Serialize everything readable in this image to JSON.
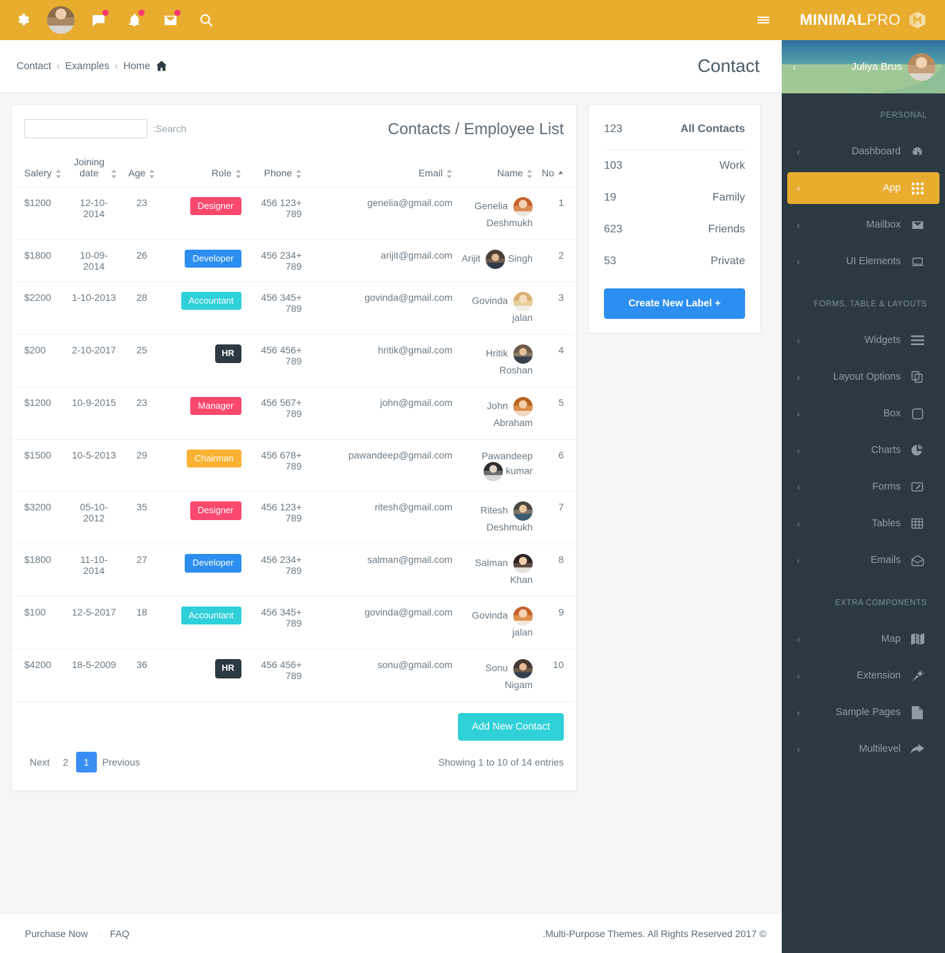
{
  "topbar": {
    "icons": [
      {
        "name": "gear-icon",
        "label": "Settings"
      },
      {
        "name": "avatar",
        "label": "Profile"
      },
      {
        "name": "chat-icon",
        "label": "Messages"
      },
      {
        "name": "bell-icon",
        "label": "Notifications"
      },
      {
        "name": "envelope-icon",
        "label": "Mail"
      },
      {
        "name": "search-icon",
        "label": "Search"
      }
    ],
    "menu_toggle": "menu-icon",
    "brand_bold": "MINIMAL",
    "brand_light": "PRO",
    "brand_color": "#e8ac2e"
  },
  "header": {
    "breadcrumb": [
      "Contact",
      "Examples",
      "Home"
    ],
    "separator": "‹",
    "title": "Contact"
  },
  "sidebar": {
    "profile_name": "Juliya Brus",
    "collapse_arrow": "‹",
    "sections": [
      {
        "title": "PERSONAL",
        "items": [
          {
            "label": "Dashboard",
            "icon": "dashboard-icon",
            "active": false
          },
          {
            "label": "App",
            "icon": "apps-grid-icon",
            "active": true
          },
          {
            "label": "Mailbox",
            "icon": "mail-icon",
            "active": false
          },
          {
            "label": "UI Elements",
            "icon": "monitor-icon",
            "active": false
          }
        ]
      },
      {
        "title": "FORMS, TABLE & LAYOUTS",
        "items": [
          {
            "label": "Widgets",
            "icon": "bars-icon",
            "active": false
          },
          {
            "label": "Layout Options",
            "icon": "copy-icon",
            "active": false
          },
          {
            "label": "Box",
            "icon": "square-icon",
            "active": false
          },
          {
            "label": "Charts",
            "icon": "pie-chart-icon",
            "active": false
          },
          {
            "label": "Forms",
            "icon": "edit-icon",
            "active": false
          },
          {
            "label": "Tables",
            "icon": "table-icon",
            "active": false
          },
          {
            "label": "Emails",
            "icon": "open-envelope-icon",
            "active": false
          }
        ]
      },
      {
        "title": "EXTRA COMPONENTS",
        "items": [
          {
            "label": "Map",
            "icon": "map-icon",
            "active": false
          },
          {
            "label": "Extension",
            "icon": "plug-icon",
            "active": false
          },
          {
            "label": "Sample Pages",
            "icon": "file-icon",
            "active": false
          },
          {
            "label": "Multilevel",
            "icon": "share-arrow-icon",
            "active": false
          }
        ]
      }
    ],
    "active_color": "#e8ac2e",
    "background": "#2b3a42"
  },
  "table_card": {
    "search_label": ":Search",
    "search_value": "",
    "search_placeholder": "",
    "title": "Contacts / Employee List",
    "columns": [
      {
        "label": "Salery",
        "sort": "both"
      },
      {
        "label": "Joining date",
        "sort": "both"
      },
      {
        "label": "Age",
        "sort": "both"
      },
      {
        "label": "Role",
        "sort": "both"
      },
      {
        "label": "Phone",
        "sort": "both"
      },
      {
        "label": "Email",
        "sort": "both"
      },
      {
        "label": "Name",
        "sort": "both"
      },
      {
        "label": "No",
        "sort": "asc"
      }
    ],
    "rows": [
      {
        "salary": "$1200",
        "join": "12-10-2014",
        "age": "23",
        "role": "Designer",
        "role_color": "#f8486e",
        "phone": "456 123+ 789",
        "email": "genelia@gmail.com",
        "name": "Genelia Deshmukh",
        "no": "1",
        "avatar": "a1"
      },
      {
        "salary": "$1800",
        "join": "10-09-2014",
        "age": "26",
        "role": "Developer",
        "role_color": "#2b8ef0",
        "phone": "456 234+ 789",
        "email": "arijit@gmail.com",
        "name": "Arijit Singh",
        "no": "2",
        "avatar": "a2"
      },
      {
        "salary": "$2200",
        "join": "1-10-2013",
        "age": "28",
        "role": "Accountant",
        "role_color": "#2fd0d8",
        "phone": "456 345+ 789",
        "email": "govinda@gmail.com",
        "name": "Govinda jalan",
        "no": "3",
        "avatar": "a3"
      },
      {
        "salary": "$200",
        "join": "2-10-2017",
        "age": "25",
        "role": "HR",
        "role_color": "#2b3a42",
        "phone": "456 456+ 789",
        "email": "hritik@gmail.com",
        "name": "Hritik Roshan",
        "no": "4",
        "avatar": "a4"
      },
      {
        "salary": "$1200",
        "join": "10-9-2015",
        "age": "23",
        "role": "Manager",
        "role_color": "#f8486e",
        "phone": "456 567+ 789",
        "email": "john@gmail.com",
        "name": "John Abraham",
        "no": "5",
        "avatar": "a5"
      },
      {
        "salary": "$1500",
        "join": "10-5-2013",
        "age": "29",
        "role": "Chairman",
        "role_color": "#f9b233",
        "phone": "456 678+ 789",
        "email": "pawandeep@gmail.com",
        "name": "Pawandeep kumar",
        "no": "6",
        "avatar": "a6"
      },
      {
        "salary": "$3200",
        "join": "05-10-2012",
        "age": "35",
        "role": "Designer",
        "role_color": "#f8486e",
        "phone": "456 123+ 789",
        "email": "ritesh@gmail.com",
        "name": "Ritesh Deshmukh",
        "no": "7",
        "avatar": "a7"
      },
      {
        "salary": "$1800",
        "join": "11-10-2014",
        "age": "27",
        "role": "Developer",
        "role_color": "#2b8ef0",
        "phone": "456 234+ 789",
        "email": "salman@gmail.com",
        "name": "Salman Khan",
        "no": "8",
        "avatar": "a8"
      },
      {
        "salary": "$100",
        "join": "12-5-2017",
        "age": "18",
        "role": "Accountant",
        "role_color": "#2fd0d8",
        "phone": "456 345+ 789",
        "email": "govinda@gmail.com",
        "name": "Govinda jalan",
        "no": "9",
        "avatar": "a9"
      },
      {
        "salary": "$4200",
        "join": "18-5-2009",
        "age": "36",
        "role": "HR",
        "role_color": "#2b3a42",
        "phone": "456 456+ 789",
        "email": "sonu@gmail.com",
        "name": "Sonu Nigam",
        "no": "10",
        "avatar": "a10"
      }
    ],
    "add_button": "Add New Contact",
    "pagination": {
      "next": "Next",
      "pages": [
        "2",
        "1"
      ],
      "active_page": "1",
      "previous": "Previous"
    },
    "showing": "Showing 1 to 10 of 14 entries"
  },
  "labels_panel": {
    "rows": [
      {
        "count": "123",
        "label": "All Contacts"
      },
      {
        "count": "103",
        "label": "Work"
      },
      {
        "count": "19",
        "label": "Family"
      },
      {
        "count": "623",
        "label": "Friends"
      },
      {
        "count": "53",
        "label": "Private"
      }
    ],
    "create_button": "Create New Label +"
  },
  "footer": {
    "purchase": "Purchase Now",
    "dot": "·",
    "faq": "FAQ",
    "copyright": ".Multi-Purpose Themes. All Rights Reserved 2017 ©"
  }
}
